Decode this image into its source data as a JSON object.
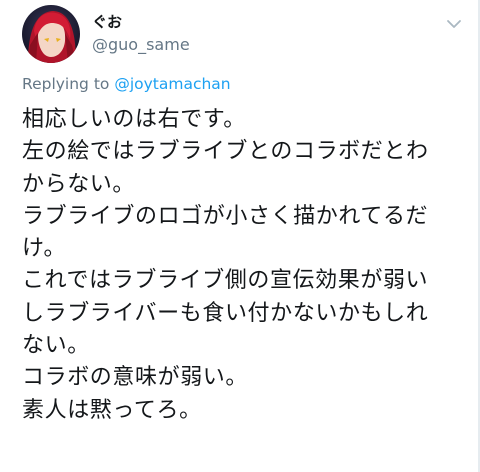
{
  "author": {
    "display_name": "ぐお",
    "handle": "@guo_same"
  },
  "reply": {
    "prefix": "Replying to ",
    "mention": "@joytamachan"
  },
  "tweet": {
    "lines": [
      "相応しいのは右です。",
      "左の絵ではラブライブとのコラボだとわ",
      "からない。",
      "ラブライブのロゴが小さく描かれてるだ",
      "け。",
      "これではラブライブ側の宣伝効果が弱い",
      "しラブライバーも食い付かないかもしれ",
      "ない。",
      "コラボの意味が弱い。",
      "素人は黙ってろ。"
    ]
  },
  "icons": {
    "avatar": "avatar-anime-red-hair",
    "menu": "chevron-down-icon"
  },
  "colors": {
    "text": "#14171a",
    "secondary": "#657786",
    "link": "#1da1f2"
  }
}
